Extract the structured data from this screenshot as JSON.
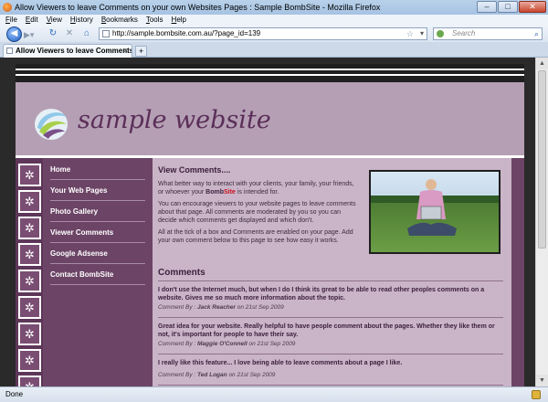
{
  "window": {
    "title": "Allow Viewers to leave Comments on your own Websites Pages : Sample BombSite - Mozilla Firefox",
    "minimize": "–",
    "maximize": "□",
    "close": "✕"
  },
  "menubar": [
    "File",
    "Edit",
    "View",
    "History",
    "Bookmarks",
    "Tools",
    "Help"
  ],
  "navigation": {
    "url": "http://sample.bombsite.com.au/?page_id=139",
    "search_placeholder": "Search",
    "icons": [
      "back-icon",
      "forward-icon",
      "reload-icon",
      "stop-icon",
      "home-icon",
      "star-icon",
      "search-icon"
    ]
  },
  "tabs": [
    {
      "label": "Allow Viewers to leave Comments on..."
    }
  ],
  "site": {
    "title": "sample website",
    "nav": [
      "Home",
      "Your Web Pages",
      "Photo Gallery",
      "Viewer Comments",
      "Google Adsense",
      "Contact BombSite"
    ],
    "view_heading": "View Comments....",
    "intro": {
      "p1_before": "What better way to interact with your clients, your family, your friends, or whoever your ",
      "p1_brand_a": "Bomb",
      "p1_brand_b": "Site",
      "p1_after": " is intended for.",
      "p2": "You can encourage viewers to your website pages to leave comments about that page. All comments are moderated by you so you can decide which comments get displayed and which don't.",
      "p3": "All at the tick of a box and Comments are enabled on your page. Add your own comment below to this page to see how easy it works."
    },
    "comments_heading": "Comments",
    "comment_by_label": "Comment By :",
    "on_label": "on",
    "comments": [
      {
        "text": "I don't use the Internet much, but when I do I think its great to be able to read other peoples comments on a website. Gives me so much more information about the topic.",
        "author": "Jack Reacher",
        "date": "21st Sep 2009"
      },
      {
        "text": "Great idea for your website. Really helpful to have people comment about the pages. Whether they like them or not, it's important for people to have their say.",
        "author": "Maggie O'Connell",
        "date": "21st Sep 2009"
      },
      {
        "text": "I really like this feature... I love being able to leave comments about a page I like.",
        "author": "Ted Logan",
        "date": "21st Sep 2009"
      }
    ]
  },
  "status": {
    "text": "Done"
  },
  "colors": {
    "accent": "#5a2e58",
    "nav_bg": "#6c4466",
    "content_bg": "#c9b4c8",
    "brand_red": "#c8121d"
  }
}
